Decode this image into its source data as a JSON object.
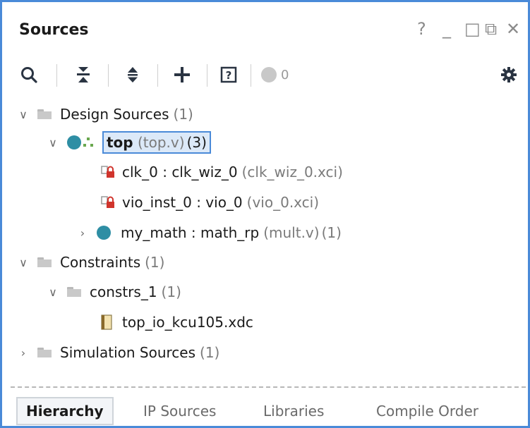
{
  "title": "Sources",
  "window_controls": [
    "?",
    "_",
    "□",
    "⧉",
    "✕"
  ],
  "toolbar": {
    "badge": "0",
    "icons": [
      "search-icon",
      "collapse-all-icon",
      "expand-icon",
      "add-icon",
      "help-icon",
      "status-dot-icon",
      "gear-icon"
    ]
  },
  "tree": {
    "design_sources": {
      "label": "Design Sources",
      "count": "(1)"
    },
    "top": {
      "label": "top",
      "file": "(top.v)",
      "count": "(3)"
    },
    "clk": {
      "label": "clk_0 : clk_wiz_0",
      "file": "(clk_wiz_0.xci)"
    },
    "vio": {
      "label": "vio_inst_0 : vio_0",
      "file": "(vio_0.xci)"
    },
    "my_math": {
      "label": "my_math : math_rp",
      "file": "(mult.v)",
      "count": "(1)"
    },
    "constraints": {
      "label": "Constraints",
      "count": "(1)"
    },
    "constrs_1": {
      "label": "constrs_1",
      "count": "(1)"
    },
    "xdc": {
      "label": "top_io_kcu105.xdc"
    },
    "simulation": {
      "label": "Simulation Sources",
      "count": "(1)"
    }
  },
  "tabs": [
    "Hierarchy",
    "IP Sources",
    "Libraries",
    "Compile Order"
  ],
  "colors": {
    "accent": "#4a8ad8",
    "module_dot": "#2e8ea4",
    "lock": "#d0342c"
  }
}
